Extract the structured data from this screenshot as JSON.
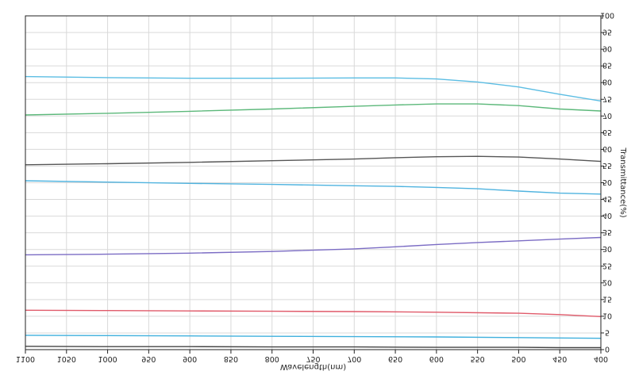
{
  "chart_data": {
    "type": "line",
    "xlabel": "Wavelength(nm)",
    "ylabel": "Transmittance(%)",
    "mirrored": true,
    "xlim": [
      400,
      1100
    ],
    "ylim": [
      0,
      100
    ],
    "x_reversed": true,
    "x_ticks": [
      1100,
      1050,
      1000,
      950,
      900,
      850,
      800,
      750,
      700,
      650,
      600,
      550,
      500,
      450,
      400
    ],
    "y_ticks": [
      0,
      5,
      10,
      15,
      20,
      25,
      30,
      35,
      40,
      45,
      50,
      55,
      60,
      65,
      70,
      75,
      80,
      85,
      90,
      95,
      100
    ],
    "grid": true,
    "series": [
      {
        "color": "#5bbde3",
        "x": [
          1100,
          1000,
          900,
          800,
          700,
          650,
          600,
          550,
          500,
          450,
          400
        ],
        "y": [
          81.8,
          81.5,
          81.3,
          81.3,
          81.4,
          81.4,
          81.1,
          80.2,
          78.7,
          76.5,
          74.5
        ]
      },
      {
        "color": "#5cb87a",
        "x": [
          1100,
          1000,
          900,
          800,
          700,
          650,
          600,
          550,
          500,
          450,
          400
        ],
        "y": [
          70.3,
          70.8,
          71.4,
          72.1,
          72.9,
          73.3,
          73.6,
          73.6,
          73.1,
          72.1,
          71.5
        ]
      },
      {
        "color": "#555555",
        "x": [
          1100,
          1000,
          900,
          800,
          700,
          650,
          600,
          550,
          500,
          450,
          400
        ],
        "y": [
          55.4,
          55.7,
          56.1,
          56.6,
          57.1,
          57.5,
          57.8,
          57.9,
          57.7,
          57.1,
          56.4
        ]
      },
      {
        "color": "#4fb3df",
        "x": [
          1100,
          1000,
          900,
          800,
          700,
          650,
          600,
          550,
          500,
          450,
          400
        ],
        "y": [
          50.6,
          50.2,
          49.8,
          49.5,
          49.1,
          48.9,
          48.6,
          48.2,
          47.5,
          46.9,
          46.6
        ]
      },
      {
        "color": "#7b6cc4",
        "x": [
          1100,
          1000,
          900,
          800,
          700,
          650,
          600,
          550,
          500,
          450,
          400
        ],
        "y": [
          28.4,
          28.6,
          28.9,
          29.4,
          30.2,
          30.8,
          31.5,
          32.1,
          32.6,
          33.1,
          33.6
        ]
      },
      {
        "color": "#e05a6a",
        "x": [
          1100,
          1000,
          900,
          800,
          700,
          600,
          500,
          450,
          400
        ],
        "y": [
          11.8,
          11.7,
          11.6,
          11.5,
          11.4,
          11.2,
          10.9,
          10.5,
          9.9
        ]
      },
      {
        "color": "#3fb0dd",
        "x": [
          1100,
          1000,
          900,
          800,
          700,
          600,
          500,
          450,
          400
        ],
        "y": [
          4.3,
          4.2,
          4.1,
          4.0,
          3.9,
          3.8,
          3.6,
          3.5,
          3.4
        ]
      },
      {
        "color": "#444444",
        "x": [
          1100,
          1000,
          900,
          800,
          700,
          600,
          500,
          450,
          400
        ],
        "y": [
          1.0,
          0.9,
          0.9,
          0.8,
          0.8,
          0.7,
          0.7,
          0.6,
          0.6
        ]
      }
    ]
  }
}
